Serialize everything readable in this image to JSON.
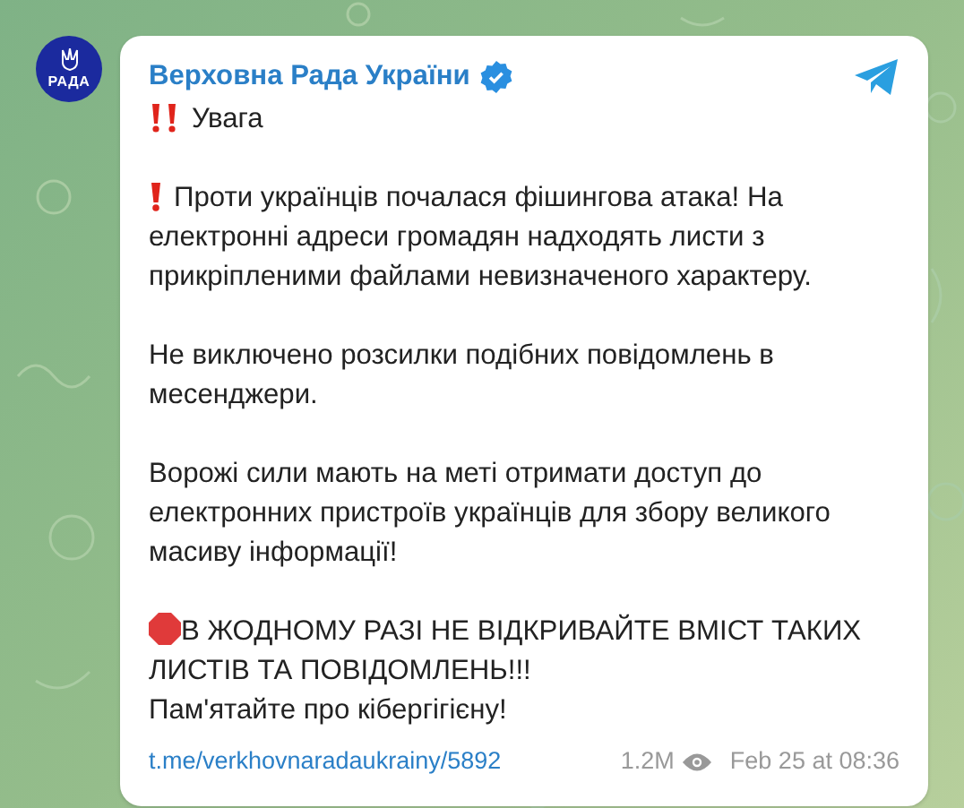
{
  "channel": {
    "avatar_text": "РАДА",
    "name": "Верховна Рада України",
    "verified": true
  },
  "paragraphs": [
    {
      "kind": "double-alert",
      "text": "Увага"
    },
    {
      "kind": "alert",
      "text": "Проти українців почалася фішингова атака! На електронні адреси громадян надходять листи з прикріпленими файлами невизначеного характеру."
    },
    {
      "kind": "plain",
      "text": "Не виключено розсилки подібних повідомлень в месенджери."
    },
    {
      "kind": "plain",
      "text": "Ворожі сили мають на меті отримати доступ до електронних пристроїв українців для збору великого масиву інформації!"
    },
    {
      "kind": "stop",
      "text": "В ЖОДНОМУ РАЗІ НЕ ВІДКРИВАЙТЕ ВМІСТ ТАКИХ ЛИСТІВ ТА ПОВІДОМЛЕНЬ!!!"
    },
    {
      "kind": "continuation",
      "text": "Пам'ятайте про кібергігієну!"
    }
  ],
  "footer": {
    "link": "t.me/verkhovnaradaukrainy/5892",
    "views": "1.2M",
    "date": "Feb 25 at 08:36"
  }
}
